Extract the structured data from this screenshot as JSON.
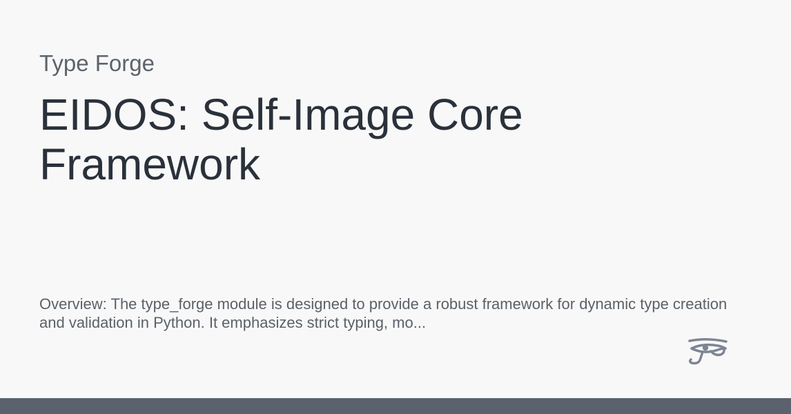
{
  "site": {
    "name": "Type Forge"
  },
  "page": {
    "title": "EIDOS: Self-Image Core Framework",
    "description": "Overview: The type_forge module is designed to provide a robust framework for dynamic type creation and validation in Python. It emphasizes strict typing, mo..."
  },
  "logo": {
    "icon": "eye-of-horus-icon",
    "color": "#7d8593"
  },
  "colors": {
    "background": "#f8f8f8",
    "title": "#2a313a",
    "muted_text": "#5c636b",
    "bottom_bar": "#5b626d"
  }
}
